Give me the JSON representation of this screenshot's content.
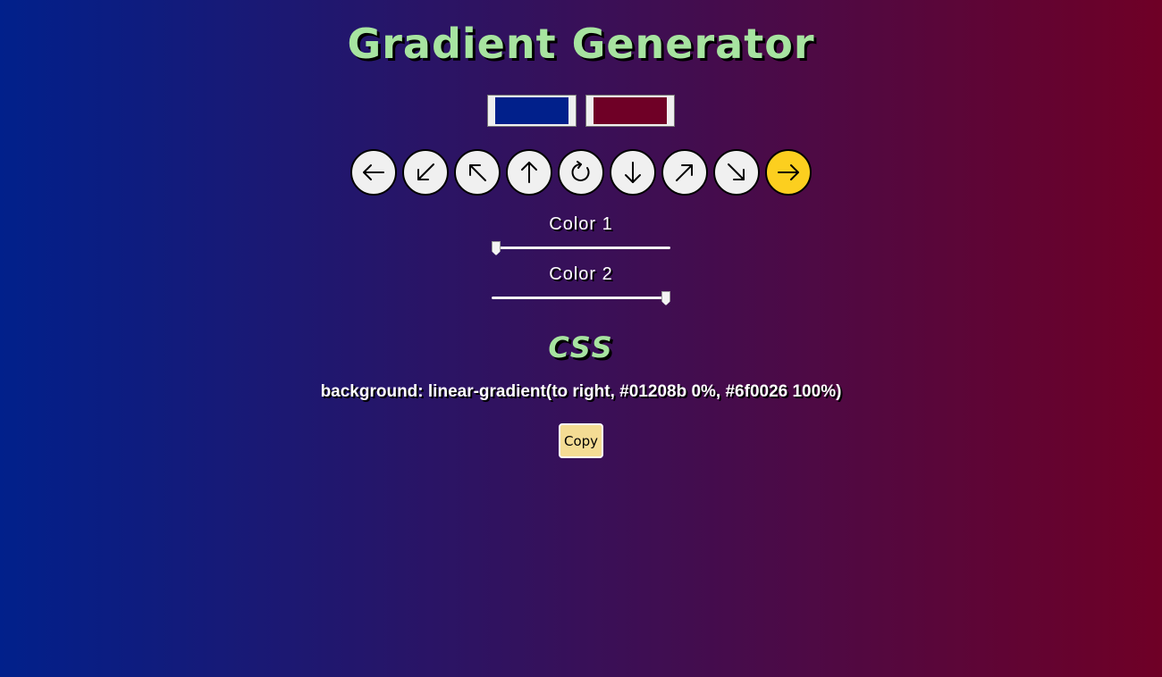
{
  "app": {
    "title": "Gradient Generator"
  },
  "colors": {
    "color1": "#01208b",
    "color2": "#6f0026",
    "active_direction_bg": "#fccf1f",
    "title_color": "#a7e4a0"
  },
  "directions": [
    {
      "icon": "arrow-left-icon",
      "glyph": "left",
      "active": false
    },
    {
      "icon": "arrow-down-left-icon",
      "glyph": "down-left",
      "active": false
    },
    {
      "icon": "arrow-up-left-icon",
      "glyph": "up-left",
      "active": false
    },
    {
      "icon": "arrow-up-icon",
      "glyph": "up",
      "active": false
    },
    {
      "icon": "radial-rotate-icon",
      "glyph": "radial",
      "active": false
    },
    {
      "icon": "arrow-down-icon",
      "glyph": "down",
      "active": false
    },
    {
      "icon": "arrow-up-right-icon",
      "glyph": "up-right",
      "active": false
    },
    {
      "icon": "arrow-down-right-icon",
      "glyph": "down-right",
      "active": false
    },
    {
      "icon": "arrow-right-icon",
      "glyph": "right",
      "active": true
    }
  ],
  "sliders": {
    "color1": {
      "label": "Color 1",
      "value_percent": 0
    },
    "color2": {
      "label": "Color 2",
      "value_percent": 100
    }
  },
  "output": {
    "heading": "CSS",
    "code": "background: linear-gradient(to right, #01208b 0%, #6f0026 100%)"
  },
  "actions": {
    "copy_label": "Copy"
  }
}
